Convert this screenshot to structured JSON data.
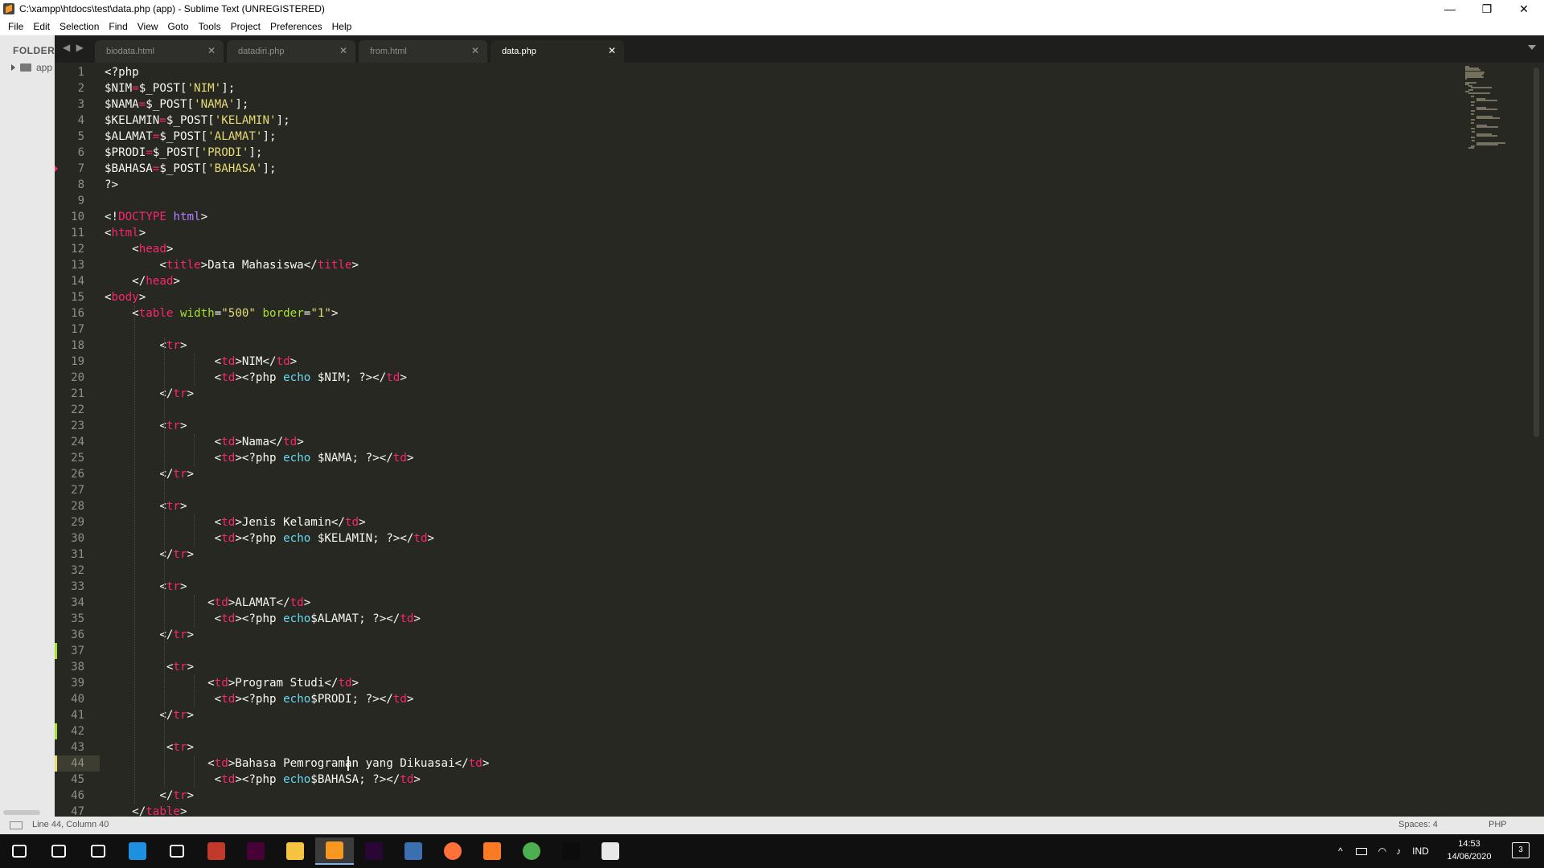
{
  "window": {
    "title": "C:\\xampp\\htdocs\\test\\data.php (app) - Sublime Text (UNREGISTERED)",
    "minimize": "—",
    "maximize": "❐",
    "close": "✕"
  },
  "menu": [
    "File",
    "Edit",
    "Selection",
    "Find",
    "View",
    "Goto",
    "Tools",
    "Project",
    "Preferences",
    "Help"
  ],
  "sidebar": {
    "header": "FOLDERS",
    "folder": "app"
  },
  "tabs": [
    {
      "label": "biodata.html",
      "active": false
    },
    {
      "label": "datadiri.php",
      "active": false
    },
    {
      "label": "from.html",
      "active": false
    },
    {
      "label": "data.php",
      "active": true
    }
  ],
  "tab_close_glyph": "✕",
  "nav_arrows": "◀ ▶",
  "editor": {
    "current_line": 44,
    "lines": [
      [
        [
          "<?php",
          ""
        ]
      ],
      [
        [
          "$NIM",
          ""
        ],
        [
          "=",
          "pink"
        ],
        [
          "$_POST[",
          ""
        ],
        [
          "'NIM'",
          "str"
        ],
        [
          "];",
          ""
        ]
      ],
      [
        [
          "$NAMA",
          ""
        ],
        [
          "=",
          "pink"
        ],
        [
          "$_POST[",
          ""
        ],
        [
          "'NAMA'",
          "str"
        ],
        [
          "];",
          ""
        ]
      ],
      [
        [
          "$KELAMIN",
          ""
        ],
        [
          "=",
          "pink"
        ],
        [
          "$_POST[",
          ""
        ],
        [
          "'KELAMIN'",
          "str"
        ],
        [
          "];",
          ""
        ]
      ],
      [
        [
          "$ALAMAT",
          ""
        ],
        [
          "=",
          "pink"
        ],
        [
          "$_POST[",
          ""
        ],
        [
          "'ALAMAT'",
          "str"
        ],
        [
          "];",
          ""
        ]
      ],
      [
        [
          "$PRODI",
          ""
        ],
        [
          "=",
          "pink"
        ],
        [
          "$_POST[",
          ""
        ],
        [
          "'PRODI'",
          "str"
        ],
        [
          "];",
          ""
        ]
      ],
      [
        [
          "$BAHASA",
          ""
        ],
        [
          "=",
          "pink"
        ],
        [
          "$_POST[",
          ""
        ],
        [
          "'BAHASA'",
          "str"
        ],
        [
          "];",
          ""
        ]
      ],
      [
        [
          "?>",
          ""
        ]
      ],
      [],
      [
        [
          "<!",
          ""
        ],
        [
          "DOCTYPE",
          "pink"
        ],
        [
          " ",
          ""
        ],
        [
          "html",
          "purple"
        ],
        [
          ">",
          ""
        ]
      ],
      [
        [
          "<",
          ""
        ],
        [
          "html",
          "pink"
        ],
        [
          ">",
          ""
        ]
      ],
      [
        [
          "    <",
          ""
        ],
        [
          "head",
          "pink"
        ],
        [
          ">",
          ""
        ]
      ],
      [
        [
          "        <",
          ""
        ],
        [
          "title",
          "pink"
        ],
        [
          ">Data Mahasiswa</",
          ""
        ],
        [
          "title",
          "pink"
        ],
        [
          ">",
          ""
        ]
      ],
      [
        [
          "    </",
          ""
        ],
        [
          "head",
          "pink"
        ],
        [
          ">",
          ""
        ]
      ],
      [
        [
          "<",
          ""
        ],
        [
          "body",
          "pink"
        ],
        [
          ">",
          ""
        ]
      ],
      [
        [
          "    <",
          ""
        ],
        [
          "table",
          "pink"
        ],
        [
          " ",
          ""
        ],
        [
          "width",
          "attr"
        ],
        [
          "=",
          ""
        ],
        [
          "\"500\"",
          "str"
        ],
        [
          " ",
          ""
        ],
        [
          "border",
          "attr"
        ],
        [
          "=",
          ""
        ],
        [
          "\"1\"",
          "str"
        ],
        [
          ">",
          ""
        ]
      ],
      [],
      [
        [
          "        <",
          ""
        ],
        [
          "tr",
          "pink"
        ],
        [
          ">",
          ""
        ]
      ],
      [
        [
          "                <",
          ""
        ],
        [
          "td",
          "pink"
        ],
        [
          ">NIM</",
          ""
        ],
        [
          "td",
          "pink"
        ],
        [
          ">",
          ""
        ]
      ],
      [
        [
          "                <",
          ""
        ],
        [
          "td",
          "pink"
        ],
        [
          "><?php ",
          ""
        ],
        [
          "echo",
          "blue"
        ],
        [
          " $NIM; ?></",
          ""
        ],
        [
          "td",
          "pink"
        ],
        [
          ">",
          ""
        ]
      ],
      [
        [
          "        </",
          ""
        ],
        [
          "tr",
          "pink"
        ],
        [
          ">",
          ""
        ]
      ],
      [],
      [
        [
          "        <",
          ""
        ],
        [
          "tr",
          "pink"
        ],
        [
          ">",
          ""
        ]
      ],
      [
        [
          "                <",
          ""
        ],
        [
          "td",
          "pink"
        ],
        [
          ">Nama</",
          ""
        ],
        [
          "td",
          "pink"
        ],
        [
          ">",
          ""
        ]
      ],
      [
        [
          "                <",
          ""
        ],
        [
          "td",
          "pink"
        ],
        [
          "><?php ",
          ""
        ],
        [
          "echo",
          "blue"
        ],
        [
          " $NAMA; ?></",
          ""
        ],
        [
          "td",
          "pink"
        ],
        [
          ">",
          ""
        ]
      ],
      [
        [
          "        </",
          ""
        ],
        [
          "tr",
          "pink"
        ],
        [
          ">",
          ""
        ]
      ],
      [],
      [
        [
          "        <",
          ""
        ],
        [
          "tr",
          "pink"
        ],
        [
          ">",
          ""
        ]
      ],
      [
        [
          "                <",
          ""
        ],
        [
          "td",
          "pink"
        ],
        [
          ">Jenis Kelamin</",
          ""
        ],
        [
          "td",
          "pink"
        ],
        [
          ">",
          ""
        ]
      ],
      [
        [
          "                <",
          ""
        ],
        [
          "td",
          "pink"
        ],
        [
          "><?php ",
          ""
        ],
        [
          "echo",
          "blue"
        ],
        [
          " $KELAMIN; ?></",
          ""
        ],
        [
          "td",
          "pink"
        ],
        [
          ">",
          ""
        ]
      ],
      [
        [
          "        </",
          ""
        ],
        [
          "tr",
          "pink"
        ],
        [
          ">",
          ""
        ]
      ],
      [],
      [
        [
          "        <",
          ""
        ],
        [
          "tr",
          "pink"
        ],
        [
          ">",
          ""
        ]
      ],
      [
        [
          "               <",
          ""
        ],
        [
          "td",
          "pink"
        ],
        [
          ">ALAMAT</",
          ""
        ],
        [
          "td",
          "pink"
        ],
        [
          ">",
          ""
        ]
      ],
      [
        [
          "                <",
          ""
        ],
        [
          "td",
          "pink"
        ],
        [
          "><?php ",
          ""
        ],
        [
          "echo",
          "blue"
        ],
        [
          "$ALAMAT; ?></",
          ""
        ],
        [
          "td",
          "pink"
        ],
        [
          ">",
          ""
        ]
      ],
      [
        [
          "        </",
          ""
        ],
        [
          "tr",
          "pink"
        ],
        [
          ">",
          ""
        ]
      ],
      [],
      [
        [
          "         <",
          ""
        ],
        [
          "tr",
          "pink"
        ],
        [
          ">",
          ""
        ]
      ],
      [
        [
          "               <",
          ""
        ],
        [
          "td",
          "pink"
        ],
        [
          ">Program Studi</",
          ""
        ],
        [
          "td",
          "pink"
        ],
        [
          ">",
          ""
        ]
      ],
      [
        [
          "                <",
          ""
        ],
        [
          "td",
          "pink"
        ],
        [
          "><?php ",
          ""
        ],
        [
          "echo",
          "blue"
        ],
        [
          "$PRODI; ?></",
          ""
        ],
        [
          "td",
          "pink"
        ],
        [
          ">",
          ""
        ]
      ],
      [
        [
          "        </",
          ""
        ],
        [
          "tr",
          "pink"
        ],
        [
          ">",
          ""
        ]
      ],
      [],
      [
        [
          "         <",
          ""
        ],
        [
          "tr",
          "pink"
        ],
        [
          ">",
          ""
        ]
      ],
      [
        [
          "               <",
          ""
        ],
        [
          "td",
          "pink"
        ],
        [
          ">Bahasa Pemrograman yang Dikuasai</",
          ""
        ],
        [
          "td",
          "pink"
        ],
        [
          ">",
          ""
        ]
      ],
      [
        [
          "                <",
          ""
        ],
        [
          "td",
          "pink"
        ],
        [
          "><?php ",
          ""
        ],
        [
          "echo",
          "blue"
        ],
        [
          "$BAHASA; ?></",
          ""
        ],
        [
          "td",
          "pink"
        ],
        [
          ">",
          ""
        ]
      ],
      [
        [
          "        </",
          ""
        ],
        [
          "tr",
          "pink"
        ],
        [
          ">",
          ""
        ]
      ],
      [
        [
          "    </",
          ""
        ],
        [
          "table",
          "pink"
        ],
        [
          ">",
          ""
        ]
      ]
    ]
  },
  "status": {
    "position": "Line 44, Column 40",
    "indentation": "Spaces: 4",
    "syntax": "PHP"
  },
  "taskbar": {
    "apps": [
      {
        "name": "start-icon",
        "color": "#ffffff"
      },
      {
        "name": "search-icon",
        "color": "#ffffff"
      },
      {
        "name": "task-view-icon",
        "color": "#ffffff"
      },
      {
        "name": "edge-icon",
        "color": "#1f8fe0"
      },
      {
        "name": "mail-icon",
        "color": "#ffffff"
      },
      {
        "name": "car-game-icon",
        "color": "#c0392b"
      },
      {
        "name": "adobe-xd-icon",
        "color": "#470137"
      },
      {
        "name": "file-explorer-icon",
        "color": "#f5c542"
      },
      {
        "name": "sublime-text-icon",
        "color": "#f89820"
      },
      {
        "name": "premiere-pro-icon",
        "color": "#2a0634"
      },
      {
        "name": "game-app-icon",
        "color": "#3a6fb0"
      },
      {
        "name": "firefox-icon",
        "color": "#ff7139"
      },
      {
        "name": "xampp-icon",
        "color": "#fb7a24"
      },
      {
        "name": "chrome-icon",
        "color": "#4caf50"
      },
      {
        "name": "terminal-icon",
        "color": "#0c0c0c"
      },
      {
        "name": "paint-app-icon",
        "color": "#e8e8e8"
      }
    ],
    "language": "IND",
    "time": "14:53",
    "date": "14/06/2020",
    "notification_count": "3"
  }
}
